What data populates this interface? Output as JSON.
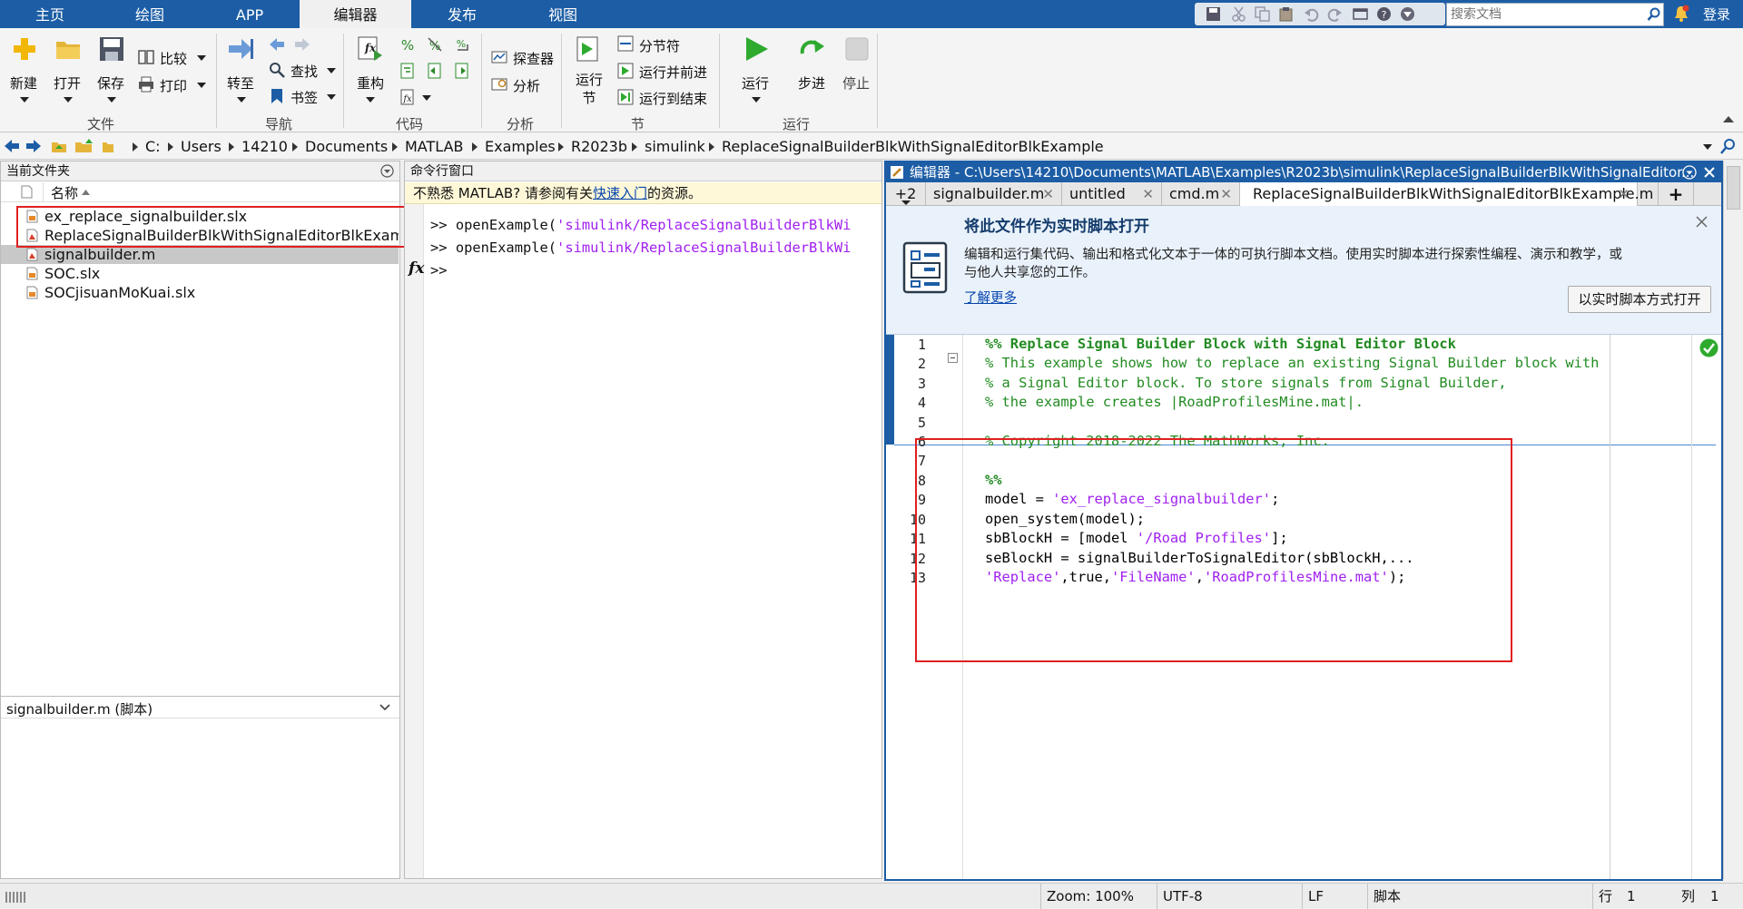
{
  "top_tabs": [
    "主页",
    "绘图",
    "APP",
    "编辑器",
    "发布",
    "视图"
  ],
  "active_tab": "编辑器",
  "search": {
    "placeholder": "搜索文档"
  },
  "login_label": "登录",
  "ribbon": {
    "file": {
      "new": "新建",
      "open": "打开",
      "save": "保存",
      "compare": "比较",
      "print": "打印",
      "group": "文件"
    },
    "nav": {
      "goto": "转至",
      "find": "查找",
      "bookmark": "书签",
      "group": "导航"
    },
    "code": {
      "refactor": "重构",
      "group": "代码"
    },
    "analyze": {
      "explorer": "探查器",
      "analyze": "分析",
      "group": "分析"
    },
    "section": {
      "run_section": "运行\n节",
      "section_break": "分节符",
      "run_and_advance": "运行并前进",
      "run_to_end": "运行到结束",
      "group": "节"
    },
    "run": {
      "run": "运行",
      "step": "步进",
      "stop": "停止",
      "group": "运行"
    }
  },
  "address": [
    "C:",
    "Users",
    "14210",
    "Documents",
    "MATLAB",
    "Examples",
    "R2023b",
    "simulink",
    "ReplaceSignalBuilderBlkWithSignalEditorBlkExample"
  ],
  "left_panel": {
    "title": "当前文件夹",
    "col_name": "名称",
    "files": [
      {
        "name": "ex_replace_signalbuilder.slx",
        "type": "slx"
      },
      {
        "name": "ReplaceSignalBuilderBlkWithSignalEditorBlkExample...",
        "type": "m"
      },
      {
        "name": "signalbuilder.m",
        "type": "m",
        "selected": true
      },
      {
        "name": "SOC.slx",
        "type": "slx"
      },
      {
        "name": "SOCjisuanMoKuai.slx",
        "type": "slx"
      }
    ],
    "details_title": "signalbuilder.m  (脚本)"
  },
  "command_window": {
    "title": "命令行窗口",
    "notice_prefix": "不熟悉 MATLAB? 请参阅有关",
    "notice_link": "快速入门",
    "notice_suffix": "的资源。",
    "prompt": ">>",
    "fx": "fx",
    "lines": [
      {
        "cmd": "openExample",
        "arg": "'simulink/ReplaceSignalBuilderBlkWi"
      },
      {
        "cmd": "openExample",
        "arg": "'simulink/ReplaceSignalBuilderBlkWi"
      }
    ]
  },
  "editor": {
    "title": "编辑器 - C:\\Users\\14210\\Documents\\MATLAB\\Examples\\R2023b\\simulink\\ReplaceSignalBuilderBlkWithSignalEditor...",
    "overflow": "+2",
    "tabs": [
      "signalbuilder.m",
      "untitled",
      "cmd.m",
      "ReplaceSignalBuilderBlkWithSignalEditorBlkExample.m"
    ],
    "add_tab": "+",
    "banner": {
      "title": "将此文件作为实时脚本打开",
      "text_line1": "编辑和运行集代码、输出和格式化文本于一体的可执行脚本文档。使用实时脚本进行探索性编程、演示和教学，或",
      "text_line2": "与他人共享您的工作。",
      "learn_more": "了解更多",
      "open_button": "以实时脚本方式打开"
    },
    "code_lines": [
      {
        "n": "1",
        "parts": [
          [
            "cmt",
            "%% Replace Signal Builder Block with Signal Editor Block"
          ]
        ]
      },
      {
        "n": "2",
        "parts": [
          [
            "cmt",
            "% This example shows how to replace an existing Signal Builder block with"
          ]
        ]
      },
      {
        "n": "3",
        "parts": [
          [
            "cmt",
            "% a Signal Editor block. To store signals from Signal Builder,"
          ]
        ]
      },
      {
        "n": "4",
        "parts": [
          [
            "cmt",
            "% the example creates |RoadProfilesMine.mat|."
          ]
        ]
      },
      {
        "n": "5",
        "parts": []
      },
      {
        "n": "6",
        "parts": [
          [
            "cmt",
            "% Copyright 2018-2022 The MathWorks, Inc."
          ]
        ]
      },
      {
        "n": "7",
        "parts": []
      },
      {
        "n": "8",
        "parts": [
          [
            "cmt",
            "%%"
          ]
        ]
      },
      {
        "n": "9",
        "parts": [
          [
            "",
            "model = "
          ],
          [
            "str",
            "'ex_replace_signalbuilder'"
          ],
          [
            "",
            ";"
          ]
        ]
      },
      {
        "n": "10",
        "parts": [
          [
            "",
            "open_system(model);"
          ]
        ]
      },
      {
        "n": "11",
        "parts": [
          [
            "",
            "sbBlockH = [model "
          ],
          [
            "str",
            "'/Road Profiles'"
          ],
          [
            "",
            "];"
          ]
        ]
      },
      {
        "n": "12",
        "parts": [
          [
            "",
            "seBlockH = signalBuilderToSignalEditor(sbBlockH,..."
          ]
        ]
      },
      {
        "n": "13",
        "parts": [
          [
            "str",
            "'Replace'"
          ],
          [
            "",
            ",true,"
          ],
          [
            "str",
            "'FileName'"
          ],
          [
            "",
            ","
          ],
          [
            "str",
            "'RoadProfilesMine.mat'"
          ],
          [
            "",
            ");"
          ]
        ]
      }
    ]
  },
  "status_bar": {
    "zoom": "Zoom: 100%",
    "encoding": "UTF-8",
    "eol": "LF",
    "type": "脚本",
    "row_label": "行",
    "row": "1",
    "col_label": "列",
    "col": "1"
  },
  "colors": {
    "accent": "#1c5da5",
    "comment": "#228b22",
    "string": "#a020f0",
    "highlight": "#e02020"
  }
}
